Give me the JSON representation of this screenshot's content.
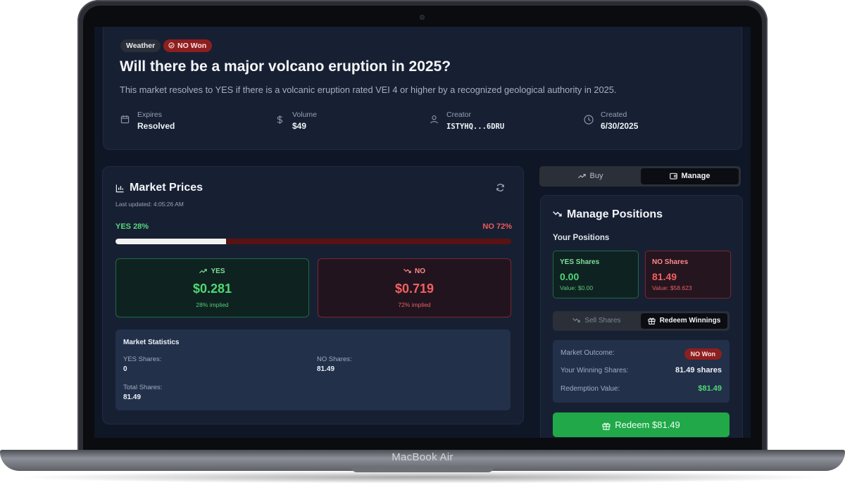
{
  "device": {
    "brand_label": "MacBook Air"
  },
  "market": {
    "category": "Weather",
    "status_badge": "NO Won",
    "title": "Will there be a major volcano eruption in 2025?",
    "description": "This market resolves to YES if there is a volcanic eruption rated VEI 4 or higher by a recognized geological authority in 2025.",
    "meta": {
      "expires_label": "Expires",
      "expires_value": "Resolved",
      "volume_label": "Volume",
      "volume_value": "$49",
      "creator_label": "Creator",
      "creator_value": "ISTYHQ...6DRU",
      "created_label": "Created",
      "created_value": "6/30/2025"
    }
  },
  "prices": {
    "title": "Market Prices",
    "last_updated": "Last updated: 4:05:26 AM",
    "yes_percent_label": "YES 28%",
    "no_percent_label": "NO 72%",
    "yes_fraction": 0.28,
    "yes": {
      "label": "YES",
      "price": "$0.281",
      "implied": "28% implied"
    },
    "no": {
      "label": "NO",
      "price": "$0.719",
      "implied": "72% implied"
    },
    "stats": {
      "title": "Market Statistics",
      "yes_shares_label": "YES Shares:",
      "yes_shares_value": "0",
      "no_shares_label": "NO Shares:",
      "no_shares_value": "81.49",
      "total_shares_label": "Total Shares:",
      "total_shares_value": "81.49"
    }
  },
  "tabs": {
    "buy": "Buy",
    "manage": "Manage",
    "active": "Manage"
  },
  "manage": {
    "title": "Manage Positions",
    "your_positions": "Your Positions",
    "yes_box": {
      "label": "YES Shares",
      "value": "0.00",
      "sub": "Value: $0.00"
    },
    "no_box": {
      "label": "NO Shares",
      "value": "81.49",
      "sub": "Value: $58.623"
    },
    "subtabs": {
      "sell": "Sell Shares",
      "redeem": "Redeem Winnings",
      "active": "Redeem Winnings"
    },
    "outcome_label": "Market Outcome:",
    "outcome_value": "NO Won",
    "winning_label": "Your Winning Shares:",
    "winning_value": "81.49 shares",
    "redemption_label": "Redemption Value:",
    "redemption_value": "$81.49",
    "redeem_button": "Redeem $81.49"
  },
  "colors": {
    "background": "#0f1626",
    "card": "#172033",
    "yes": "#4fd874",
    "no": "#f26060",
    "button_green": "#20a849",
    "badge_red": "#8e1f1f"
  },
  "icons": [
    "calendar-icon",
    "dollar-icon",
    "user-icon",
    "clock-icon",
    "bar-chart-icon",
    "refresh-icon",
    "trending-up-icon",
    "trending-down-icon",
    "wallet-icon",
    "gift-icon",
    "check-circle-icon"
  ]
}
